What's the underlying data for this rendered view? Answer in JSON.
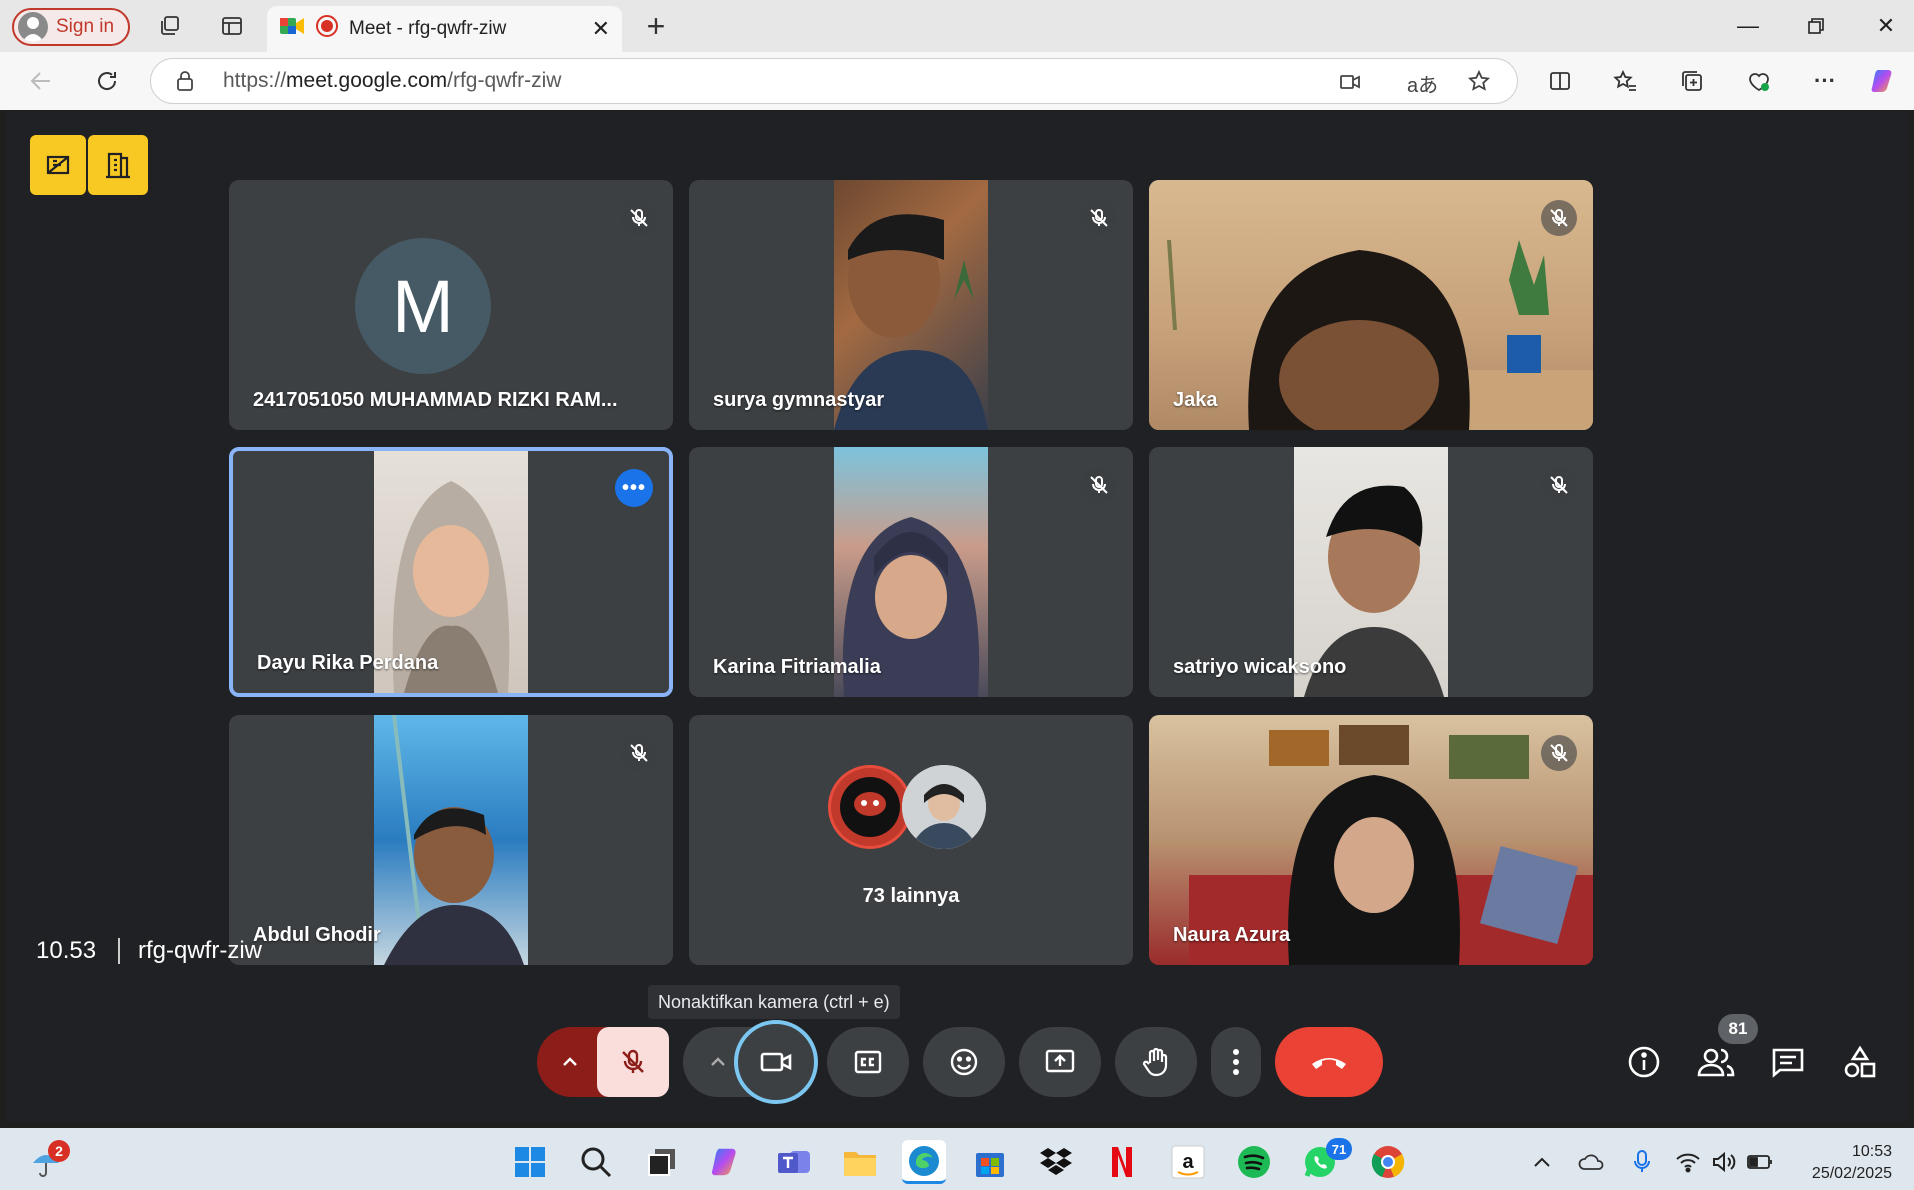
{
  "browser": {
    "sign_in_label": "Sign in",
    "tab_title": "Meet - rfg-qwfr-ziw",
    "url_scheme": "https://",
    "url_host": "meet.google.com",
    "url_path": "/rfg-qwfr-ziw"
  },
  "meeting": {
    "time": "10.53",
    "room_code": "rfg-qwfr-ziw",
    "tooltip": "Nonaktifkan kamera (ctrl + e)",
    "participant_count": "81"
  },
  "tiles": [
    {
      "name": "2417051050 MUHAMMAD RIZKI RAM...",
      "avatar_letter": "M"
    },
    {
      "name": "surya gymnastyar"
    },
    {
      "name": "Jaka"
    },
    {
      "name": "Dayu Rika Perdana"
    },
    {
      "name": "Karina Fitriamalia"
    },
    {
      "name": "satriyo wicaksono"
    },
    {
      "name": "Abdul Ghodir"
    },
    {
      "name": "73 lainnya"
    },
    {
      "name": "Naura Azura"
    }
  ],
  "taskbar": {
    "weather_badge": "2",
    "whatsapp_badge": "71",
    "time": "10:53",
    "date": "25/02/2025"
  },
  "colors": {
    "meet_bg": "#202124",
    "tile_bg": "#3c4043",
    "end_call": "#ea4335",
    "accent_yellow": "#f9c923",
    "active_border": "#8ab4f8"
  }
}
